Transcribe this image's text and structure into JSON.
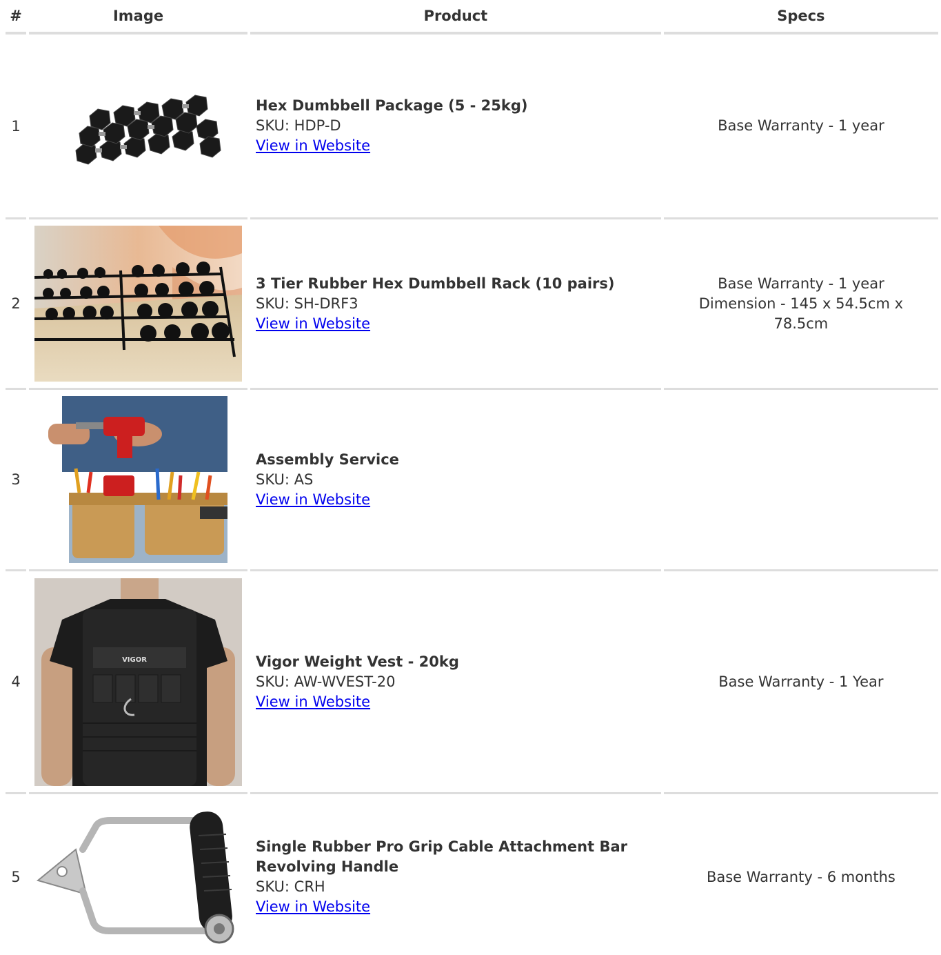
{
  "headers": {
    "num": "#",
    "image": "Image",
    "product": "Product",
    "specs": "Specs"
  },
  "rows": [
    {
      "num": "1",
      "image_alt": "hex-dumbbells-stack",
      "name": "Hex Dumbbell Package (5 - 25kg)",
      "sku": "SKU: HDP-D",
      "link": "View in Website",
      "specs": [
        "Base Warranty - 1 year"
      ]
    },
    {
      "num": "2",
      "image_alt": "dumbbell-rack-photo",
      "name": "3 Tier Rubber Hex Dumbbell Rack (10 pairs)",
      "sku": "SKU: SH-DRF3",
      "link": "View in Website",
      "specs": [
        "Base Warranty - 1 year",
        "Dimension - 145 x 54.5cm x 78.5cm"
      ]
    },
    {
      "num": "3",
      "image_alt": "tool-belt-drill-photo",
      "name": "Assembly Service",
      "sku": "SKU: AS",
      "link": "View in Website",
      "specs": []
    },
    {
      "num": "4",
      "image_alt": "weight-vest-photo",
      "name": "Vigor Weight Vest - 20kg",
      "sku": "SKU: AW-WVEST-20",
      "link": "View in Website",
      "specs": [
        "Base Warranty - 1 Year"
      ],
      "vest_label": "VIGOR"
    },
    {
      "num": "5",
      "image_alt": "cable-handle-photo",
      "name": "Single Rubber Pro Grip Cable Attachment Bar Revolving Handle",
      "sku": "SKU: CRH",
      "link": "View in Website",
      "specs": [
        "Base Warranty - 6 months"
      ]
    }
  ]
}
